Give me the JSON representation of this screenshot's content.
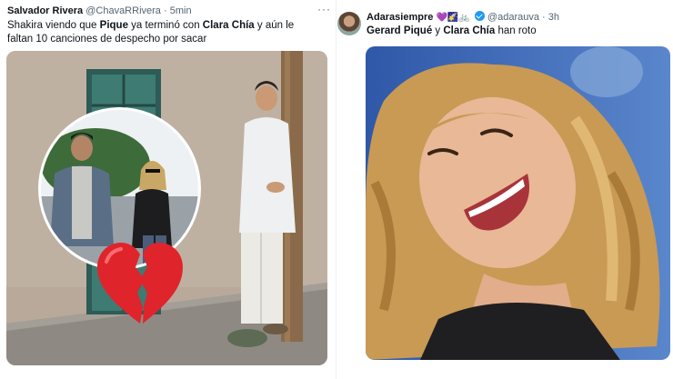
{
  "left_tweet": {
    "display_name": "Salvador Rivera",
    "handle": "@ChavaRRivera",
    "separator": "·",
    "time": "5min",
    "more": "···",
    "text": {
      "p1": "Shakira viendo que ",
      "b1": "Pique",
      "p2": " ya terminó con ",
      "b2": "Clara Chía",
      "p3": " y aún le faltan 10 canciones de despecho por sacar"
    },
    "media": {
      "inset_photo": "pique-and-clara-chia-photo",
      "emoji": "broken-heart-emoji",
      "main_photo": "man-leaning-on-post-photo"
    }
  },
  "right_tweet": {
    "display_name": "Adarasiempre",
    "emojis": "💜🌠🚲",
    "handle": "@adarauva",
    "separator": "·",
    "time": "3h",
    "text": {
      "b1": "Gerard Piqué",
      "p1": " y ",
      "b2": "Clara Chía",
      "p2": " han roto"
    },
    "media": {
      "photo": "woman-laughing-photo"
    }
  },
  "colors": {
    "text": "#0f1419",
    "secondary": "#536471",
    "verified": "#1d9bf0",
    "divider": "#eceff1"
  }
}
